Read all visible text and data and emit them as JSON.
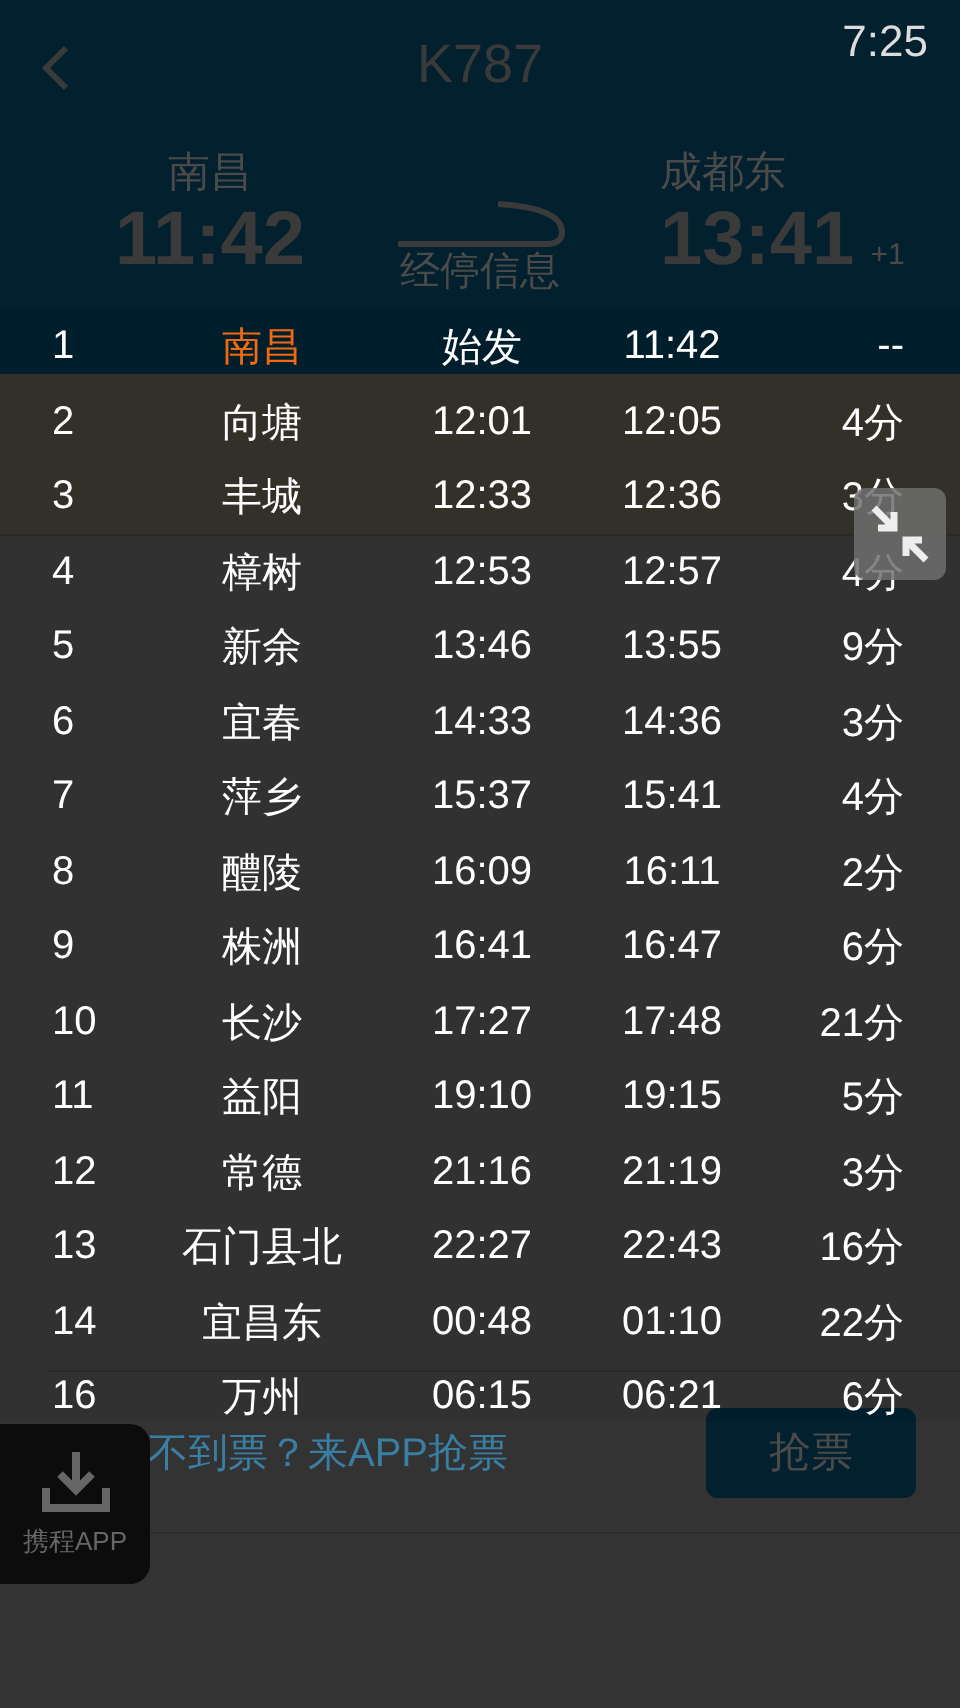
{
  "status_bar": {
    "time": "7:25"
  },
  "header": {
    "title": "K787",
    "from": {
      "station": "南昌",
      "time": "11:42"
    },
    "to": {
      "station": "成都东",
      "time": "13:41",
      "day_offset": "+1"
    },
    "stops_link": "经停信息"
  },
  "grab": {
    "text": "不到票？来APP抢票",
    "button": "抢票"
  },
  "app_button": {
    "label": "携程APP"
  },
  "stops": [
    {
      "no": "1",
      "station": "南昌",
      "arrive": "始发",
      "depart": "11:42",
      "stay": "--",
      "selected": true
    },
    {
      "no": "2",
      "station": "向塘",
      "arrive": "12:01",
      "depart": "12:05",
      "stay": "4分",
      "selected": false
    },
    {
      "no": "3",
      "station": "丰城",
      "arrive": "12:33",
      "depart": "12:36",
      "stay": "3分",
      "selected": false
    },
    {
      "no": "4",
      "station": "樟树",
      "arrive": "12:53",
      "depart": "12:57",
      "stay": "4分",
      "selected": false
    },
    {
      "no": "5",
      "station": "新余",
      "arrive": "13:46",
      "depart": "13:55",
      "stay": "9分",
      "selected": false
    },
    {
      "no": "6",
      "station": "宜春",
      "arrive": "14:33",
      "depart": "14:36",
      "stay": "3分",
      "selected": false
    },
    {
      "no": "7",
      "station": "萍乡",
      "arrive": "15:37",
      "depart": "15:41",
      "stay": "4分",
      "selected": false
    },
    {
      "no": "8",
      "station": "醴陵",
      "arrive": "16:09",
      "depart": "16:11",
      "stay": "2分",
      "selected": false
    },
    {
      "no": "9",
      "station": "株洲",
      "arrive": "16:41",
      "depart": "16:47",
      "stay": "6分",
      "selected": false
    },
    {
      "no": "10",
      "station": "长沙",
      "arrive": "17:27",
      "depart": "17:48",
      "stay": "21分",
      "selected": false
    },
    {
      "no": "11",
      "station": "益阳",
      "arrive": "19:10",
      "depart": "19:15",
      "stay": "5分",
      "selected": false
    },
    {
      "no": "12",
      "station": "常德",
      "arrive": "21:16",
      "depart": "21:19",
      "stay": "3分",
      "selected": false
    },
    {
      "no": "13",
      "station": "石门县北",
      "arrive": "22:27",
      "depart": "22:43",
      "stay": "16分",
      "selected": false
    },
    {
      "no": "14",
      "station": "宜昌东",
      "arrive": "00:48",
      "depart": "01:10",
      "stay": "22分",
      "selected": false
    },
    {
      "no": "16",
      "station": "万州",
      "arrive": "06:15",
      "depart": "06:21",
      "stay": "6分",
      "selected": false
    }
  ]
}
